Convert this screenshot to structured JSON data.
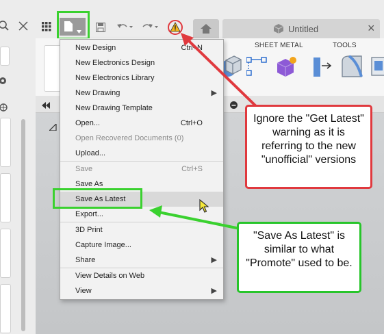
{
  "toolbar": {
    "grid_icon": "grid-icon",
    "file_icon": "file-icon",
    "save_icon": "save-icon",
    "undo_icon": "undo-icon",
    "redo_icon": "redo-icon",
    "warning_icon": "warning-icon",
    "home_icon": "home-icon",
    "tab_title": "Untitled",
    "close_glyph": "×"
  },
  "ribbon": {
    "sheet_metal_label": "SHEET METAL",
    "tools_label": "TOOLS"
  },
  "menu": {
    "items": [
      {
        "label": "New Design",
        "shortcut": "Ctrl+N"
      },
      {
        "label": "New Electronics Design"
      },
      {
        "label": "New Electronics Library"
      },
      {
        "label": "New Drawing",
        "arrow": "▶"
      },
      {
        "label": "New Drawing Template"
      },
      {
        "label": "Open...",
        "shortcut": "Ctrl+O"
      },
      {
        "label": "Open Recovered Documents (0)"
      },
      {
        "label": "Upload..."
      },
      {
        "label": "Save",
        "shortcut": "Ctrl+S"
      },
      {
        "label": "Save As"
      },
      {
        "label": "Save As Latest"
      },
      {
        "label": "Export..."
      },
      {
        "label": "3D Print"
      },
      {
        "label": "Capture Image..."
      },
      {
        "label": "Share",
        "arrow": "▶"
      },
      {
        "label": "View Details on Web"
      },
      {
        "label": "View",
        "arrow": "▶"
      }
    ]
  },
  "callouts": {
    "warning_note": "Ignore the \"Get Latest\" warning as it is referring to the new \"unofficial\" versions",
    "save_note": "\"Save As Latest\" is similar to what \"Promote\" used to be."
  },
  "colors": {
    "red": "#e0393e",
    "green": "#27c52a"
  }
}
